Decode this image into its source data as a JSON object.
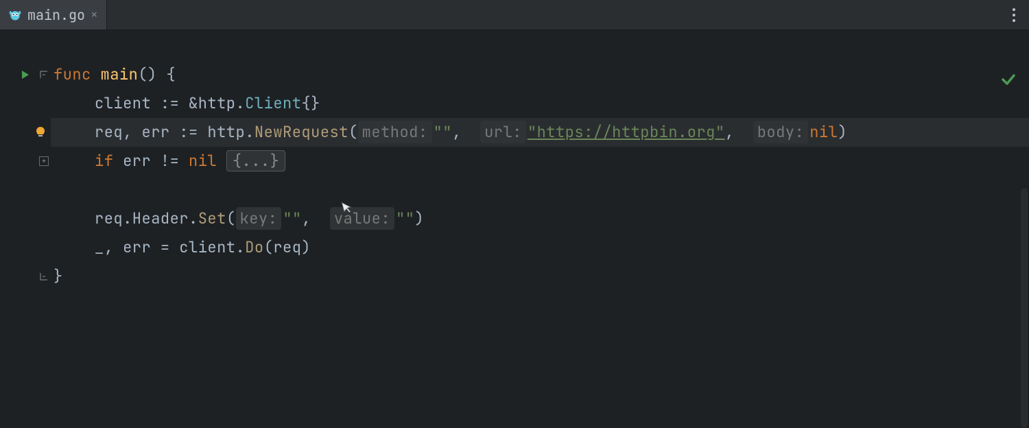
{
  "tab": {
    "filename": "main.go",
    "close_glyph": "×"
  },
  "gutter": {
    "run_tooltip": "Run",
    "bulb_tooltip": "Show intention actions",
    "fold_tooltip": "Collapse",
    "expand_tooltip": "Expand"
  },
  "status": {
    "analysis_ok": "✓"
  },
  "code": {
    "l1": {
      "kw": "func",
      "name": "main",
      "parens": "()",
      "brace": " {"
    },
    "l2": {
      "text_a": "client := &",
      "pkg": "http",
      "dot": ".",
      "type": "Client",
      "text_b": "{}"
    },
    "l3": {
      "text_a": "req, err := ",
      "pkg": "http",
      "dot": ".",
      "fn": "NewRequest",
      "open": "(",
      "hint1": "method:",
      "arg1": "\"\"",
      "comma1": ",  ",
      "hint2": "url:",
      "arg2": "\"https://httpbin.org\"",
      "comma2": ",  ",
      "hint3": "body:",
      "arg3": "nil",
      "close": ")"
    },
    "l4": {
      "kw": "if",
      "text": " err != ",
      "nil": "nil",
      "sp": " ",
      "fold": "{...}"
    },
    "l5": {
      "text_a": "req.Header.",
      "fn": "Set",
      "open": "(",
      "hint1": "key:",
      "arg1": "\"\"",
      "comma1": ",  ",
      "hint2": "value:",
      "arg2": "\"\"",
      "close": ")"
    },
    "l6": {
      "text_a": "_, err = client.",
      "fn": "Do",
      "open": "(",
      "arg": "req",
      "close": ")"
    },
    "l7": {
      "brace": "}"
    }
  }
}
